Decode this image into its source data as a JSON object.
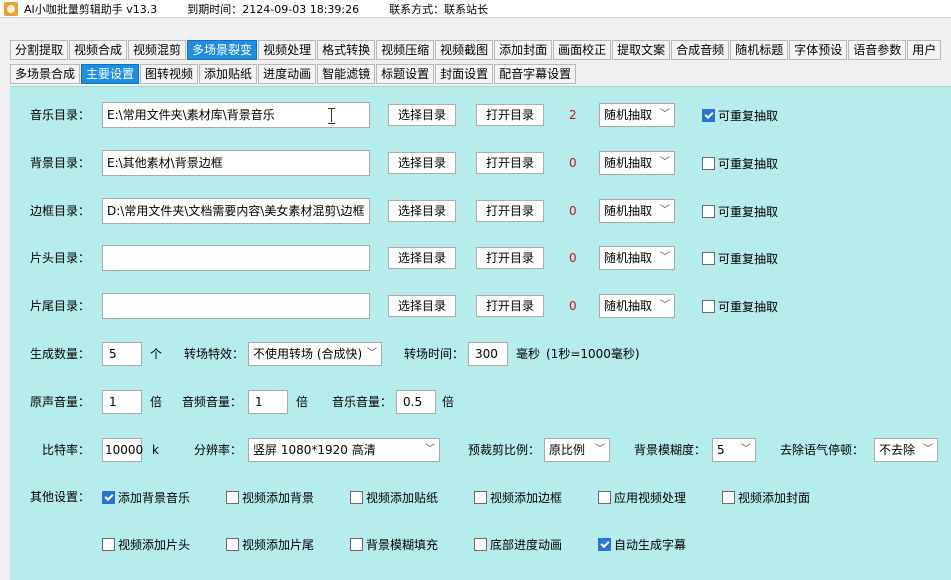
{
  "title": {
    "app_name": "AI小咖批量剪辑助手 v13.3",
    "expiry": "到期时间：2124-09-03 18:39:26",
    "contact": "联系方式：联系站长"
  },
  "tabs_main": [
    "分割提取",
    "视频合成",
    "视频混剪",
    "多场景裂变",
    "视频处理",
    "格式转换",
    "视频压缩",
    "视频截图",
    "添加封面",
    "画面校正",
    "提取文案",
    "合成音频",
    "随机标题",
    "字体预设",
    "语音参数",
    "用户"
  ],
  "tabs_sub": [
    "多场景合成",
    "主要设置",
    "图转视频",
    "添加贴纸",
    "进度动画",
    "智能滤镜",
    "标题设置",
    "封面设置",
    "配音字幕设置"
  ],
  "rows": [
    {
      "label": "音乐目录：",
      "path": "E:\\常用文件夹\\素材库\\背景音乐",
      "choose": "选择目录",
      "open": "打开目录",
      "count": "2",
      "mode": "随机抽取",
      "repeat_label": "可重复抽取",
      "repeat": true
    },
    {
      "label": "背景目录：",
      "path": "E:\\其他素材\\背景边框",
      "choose": "选择目录",
      "open": "打开目录",
      "count": "0",
      "mode": "随机抽取",
      "repeat_label": "可重复抽取",
      "repeat": false
    },
    {
      "label": "边框目录：",
      "path": "D:\\常用文件夹\\文档需要内容\\美女素材混剪\\边框",
      "choose": "选择目录",
      "open": "打开目录",
      "count": "0",
      "mode": "随机抽取",
      "repeat_label": "可重复抽取",
      "repeat": false
    },
    {
      "label": "片头目录：",
      "path": "",
      "choose": "选择目录",
      "open": "打开目录",
      "count": "0",
      "mode": "随机抽取",
      "repeat_label": "可重复抽取",
      "repeat": false
    },
    {
      "label": "片尾目录：",
      "path": "",
      "choose": "选择目录",
      "open": "打开目录",
      "count": "0",
      "mode": "随机抽取",
      "repeat_label": "可重复抽取",
      "repeat": false
    }
  ],
  "gen": {
    "count_label": "生成数量：",
    "count": "5",
    "count_unit": "个",
    "trans_label": "转场特效：",
    "trans": "不使用转场 (合成快)",
    "time_label": "转场时间：",
    "time": "300",
    "time_unit": "毫秒",
    "time_note": "(1秒=1000毫秒)"
  },
  "vol": {
    "orig_label": "原声音量：",
    "orig": "1",
    "orig_unit": "倍",
    "dub_label": "音频音量：",
    "dub": "1",
    "dub_unit": "倍",
    "music_label": "音乐音量：",
    "music": "0.5",
    "music_unit": "倍"
  },
  "bitrate": {
    "label": "比特率：",
    "value": "10000",
    "unit": "k",
    "res_label": "分辨率：",
    "res": "竖屏   1080*1920   高清",
    "crop_label": "预裁剪比例：",
    "crop": "原比例",
    "blur_label": "背景模糊度：",
    "blur": "5",
    "silence_label": "去除语气停顿：",
    "silence": "不去除"
  },
  "other": {
    "label": "其他设置：",
    "items": [
      {
        "label": "添加背景音乐",
        "on": true
      },
      {
        "label": "视频添加背景",
        "on": false
      },
      {
        "label": "视频添加贴纸",
        "on": false
      },
      {
        "label": "视频添加边框",
        "on": false
      },
      {
        "label": "应用视频处理",
        "on": false
      },
      {
        "label": "视频添加封面",
        "on": false
      },
      {
        "label": "视频添加片头",
        "on": false
      },
      {
        "label": "视频添加片尾",
        "on": false
      },
      {
        "label": "背景模糊填充",
        "on": false
      },
      {
        "label": "底部进度动画",
        "on": false
      },
      {
        "label": "自动生成字幕",
        "on": true
      }
    ]
  },
  "colors": {
    "accent": "#1e8fe0",
    "panel": "#b6ecec",
    "count_red": "#d01010",
    "check_blue": "#2a72d4"
  }
}
